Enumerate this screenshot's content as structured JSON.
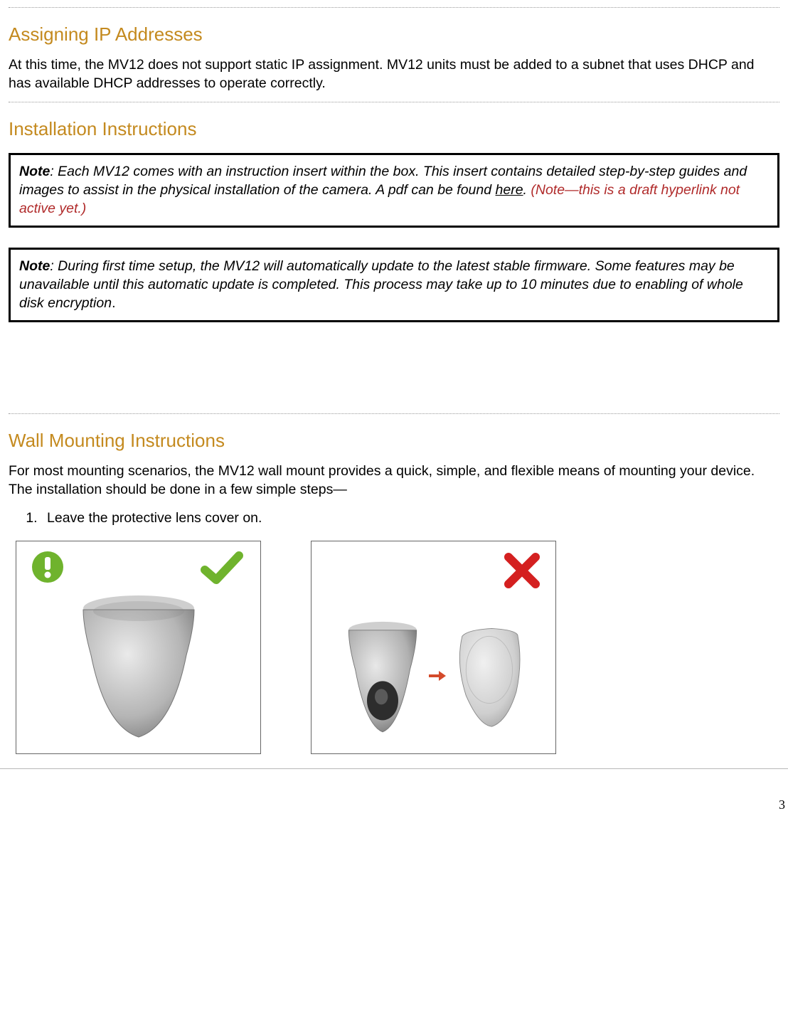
{
  "section1": {
    "heading": "Assigning IP Addresses",
    "body": "At this time, the MV12 does not support static IP assignment.  MV12 units must be added to a subnet that uses DHCP and has available DHCP addresses to operate correctly."
  },
  "section2": {
    "heading": "Installation Instructions",
    "note1_label": "Note",
    "note1_body": ": Each MV12 comes with an instruction insert within the box. This insert contains detailed step-by-step guides and images to assist in the physical installation of the camera.  A pdf can be found ",
    "note1_here": "here",
    "note1_after": ".",
    "note1_draft": "(Note—this is a draft hyperlink not active yet.)",
    "note2_label": "Note",
    "note2_body": ": During first time setup, the MV12 will automatically update to the latest stable firmware.  Some features may be unavailable until this automatic update is completed.  This process may take up to 10 minutes due to enabling of whole disk encryption",
    "note2_after": "."
  },
  "section3": {
    "heading": "Wall Mounting Instructions",
    "body": "For most mounting scenarios, the MV12 wall mount provides a quick, simple, and flexible means of mounting your device.  The installation should be done in a few simple steps—",
    "step1": "Leave the protective lens cover on."
  },
  "page_number": "3"
}
